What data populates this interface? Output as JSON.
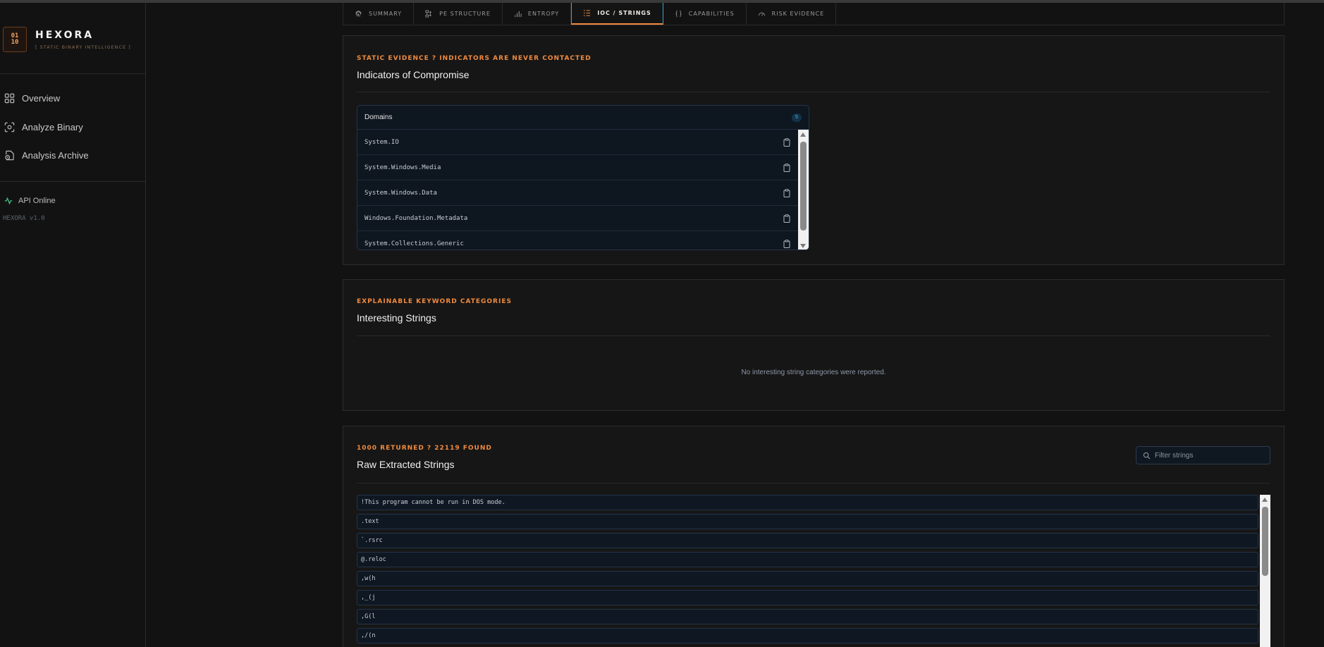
{
  "app": {
    "logo_top": "01",
    "logo_bottom": "10",
    "name": "HEXORA",
    "tagline": "[ STATIC BINARY INTELLIGENCE ]"
  },
  "sidebar": {
    "items": [
      {
        "label": "Overview",
        "icon": "grid-icon"
      },
      {
        "label": "Analyze Binary",
        "icon": "scan-icon"
      },
      {
        "label": "Analysis Archive",
        "icon": "archive-icon"
      }
    ],
    "status": "API Online",
    "version": "HEXORA v1.0"
  },
  "tabs": [
    {
      "label": "SUMMARY",
      "icon": "fingerprint-icon",
      "active": false
    },
    {
      "label": "PE STRUCTURE",
      "icon": "structure-icon",
      "active": false
    },
    {
      "label": "ENTROPY",
      "icon": "bar-chart-icon",
      "active": false
    },
    {
      "label": "IOC / STRINGS",
      "icon": "list-icon",
      "active": true
    },
    {
      "label": "CAPABILITIES",
      "icon": "braces-icon",
      "active": false
    },
    {
      "label": "RISK EVIDENCE",
      "icon": "gauge-icon",
      "active": false
    }
  ],
  "ioc_section": {
    "eyebrow": "STATIC EVIDENCE ? INDICATORS ARE NEVER CONTACTED",
    "title": "Indicators of Compromise",
    "panel": {
      "label": "Domains",
      "count": "5",
      "items": [
        "System.IO",
        "System.Windows.Media",
        "System.Windows.Data",
        "Windows.Foundation.Metadata",
        "System.Collections.Generic"
      ]
    }
  },
  "interesting_section": {
    "eyebrow": "EXPLAINABLE KEYWORD CATEGORIES",
    "title": "Interesting Strings",
    "empty_message": "No interesting string categories were reported."
  },
  "raw_section": {
    "eyebrow": "1000 RETURNED ? 22119 FOUND",
    "title": "Raw Extracted Strings",
    "filter_placeholder": "Filter strings",
    "filter_value": "",
    "strings": [
      "!This program cannot be run in DOS mode.",
      ".text",
      "`.rsrc",
      "@.reloc",
      ",w(h",
      ",_(j",
      ",G(l",
      ",/(n"
    ]
  },
  "colors": {
    "accent": "#f08a3e",
    "active_tab_border": "#3aa7c7",
    "status_green": "#3fc98a",
    "background": "#121212",
    "card": "#161616"
  }
}
